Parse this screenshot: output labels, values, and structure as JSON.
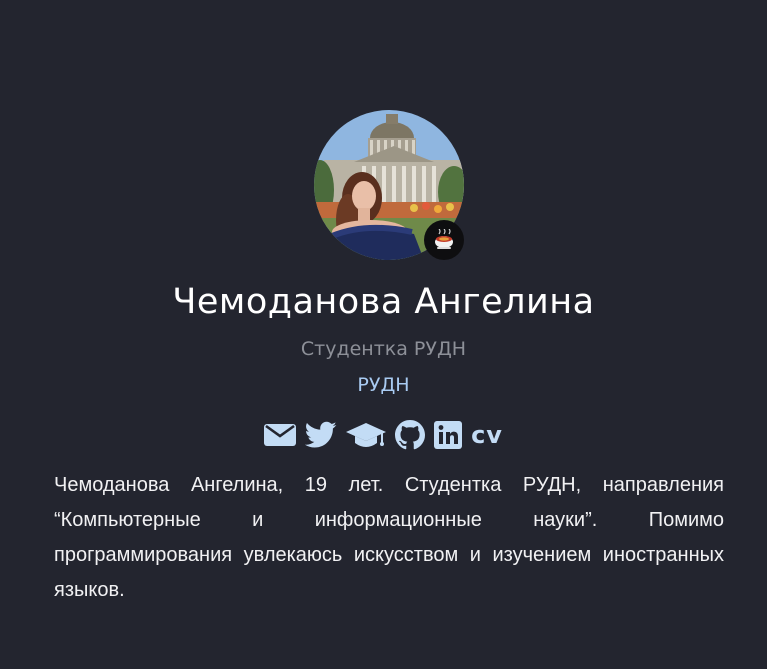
{
  "profile": {
    "name": "Чемоданова Ангелина",
    "role": "Студентка РУДН",
    "organization": "РУДН",
    "avatar_icon": "profile-photo",
    "status_icon": "tea-cup-icon",
    "social": [
      {
        "icon": "envelope-icon"
      },
      {
        "icon": "twitter-icon"
      },
      {
        "icon": "graduation-cap-icon"
      },
      {
        "icon": "github-icon"
      },
      {
        "icon": "linkedin-icon"
      },
      {
        "label": "cv"
      }
    ],
    "bio": "Чемоданова Ангелина, 19 лет. Студентка РУДН, направления “Компьютерные и информационные науки”. Помимо программирования увлекаюсь искусством и изучением иностранных языков."
  },
  "colors": {
    "background": "#23252f",
    "name": "#ffffff",
    "role": "#8d9098",
    "link": "#a9cbf2",
    "icon": "#c3dcf5"
  }
}
